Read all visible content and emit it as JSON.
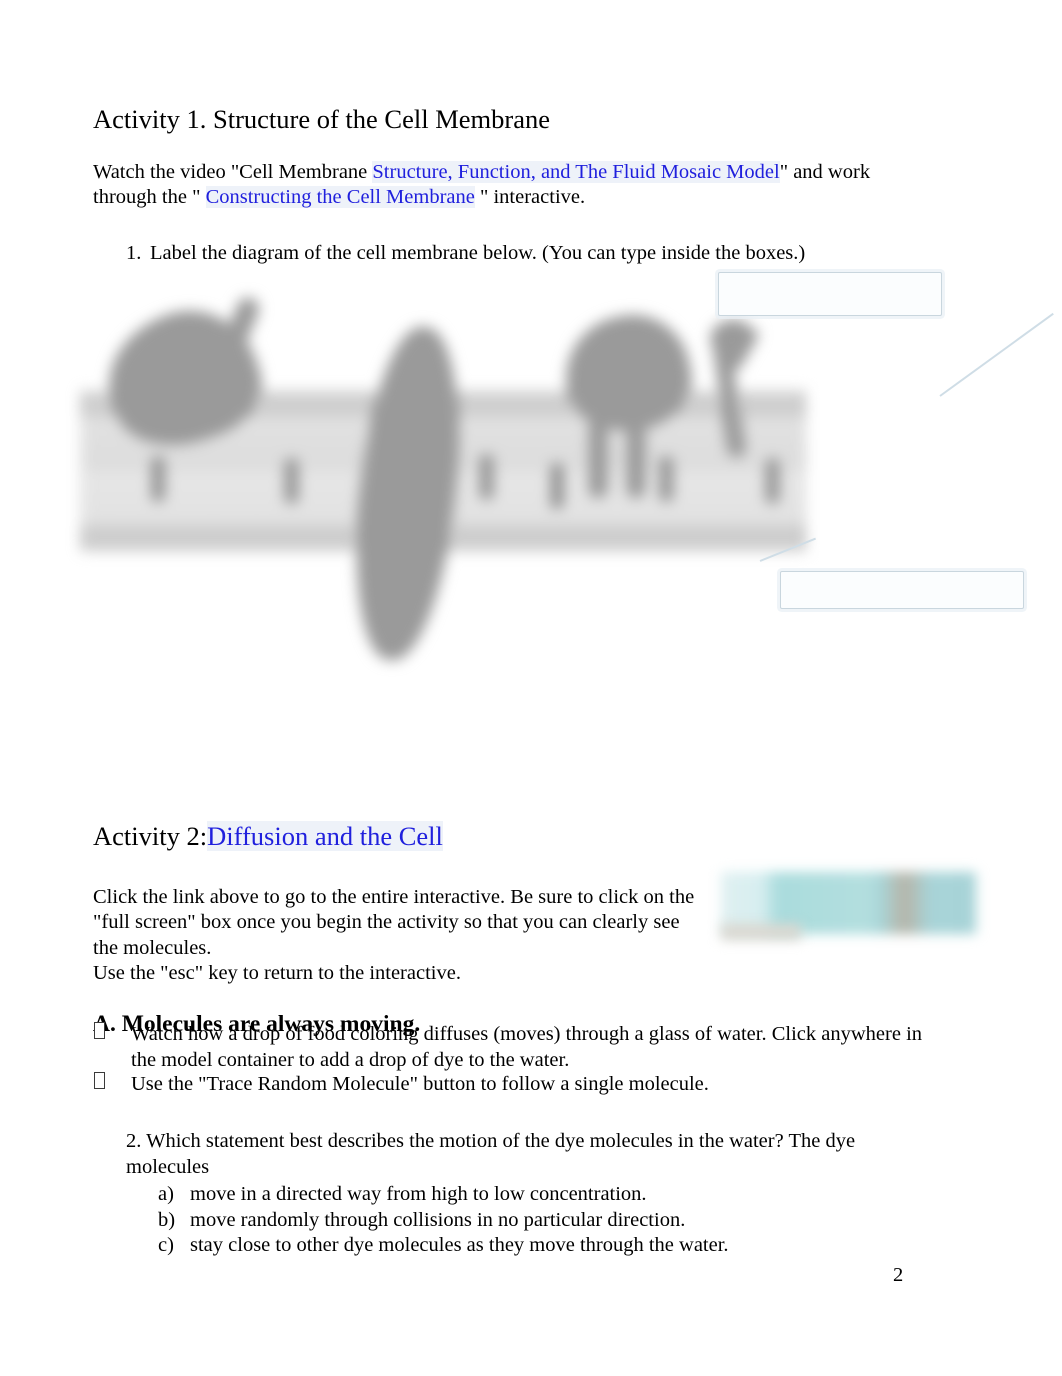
{
  "document": {
    "page_number": "2",
    "link_color": "#2020dd",
    "highlight_color": "#dae2f2"
  },
  "activity1": {
    "heading": "Activity 1. Structure of the Cell Membrane",
    "intro": {
      "before_link1": "Watch the video \"Cell Membrane ",
      "link1": "Structure, Function, and The Fluid Mosaic Model",
      "between_links": "\" and work through the \" ",
      "link2": "Constructing the Cell Membrane",
      "after_link2": " \" interactive."
    },
    "question1": {
      "number": "1.",
      "text": "Label the diagram of the cell membrane below. (You can type inside the boxes.)"
    },
    "figure": {
      "name": "cell-membrane-diagram",
      "label_box_top_value": "",
      "label_box_bottom_value": "",
      "label_box_placeholder": ""
    }
  },
  "activity2": {
    "heading_prefix": "Activity 2:",
    "heading_link": "Diffusion and the Cell",
    "paragraph_line1": "Click the link above to go to the entire interactive. Be sure to click on",
    "paragraph_line2": "the \"full screen\" box once you begin the activity so that you can clearly",
    "paragraph_line3": "see the molecules.",
    "paragraph_line4": "Use the \"esc\" key to return to the interactive.",
    "section_a": {
      "heading": "A. Molecules are always moving.",
      "bullets": [
        "Watch how a drop of food coloring diffuses (moves) through a glass of water. Click anywhere in the model container to add a drop of dye to the water.",
        "Use the \"Trace Random Molecule\" button to follow a single molecule."
      ]
    },
    "question2": {
      "text": "2. Which statement best describes the motion of the dye molecules in the water? The dye molecules",
      "options": [
        {
          "label": "a)",
          "text": "move in a directed way from high to low concentration."
        },
        {
          "label": "b)",
          "text": "move randomly through collisions in no particular direction."
        },
        {
          "label": "c)",
          "text": "stay close to other dye molecules as they move through the water."
        }
      ]
    }
  }
}
